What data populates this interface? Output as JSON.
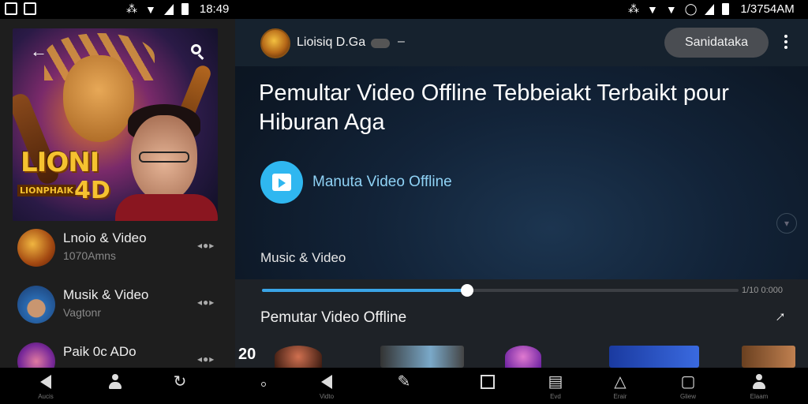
{
  "status_bar": {
    "time_left": "18:49",
    "time_right": "1/3754AM"
  },
  "left_panel": {
    "artwork": {
      "logo_text": "LIONI",
      "logo_sub": "LIONPHAIK",
      "logo_num": "4D"
    },
    "items": [
      {
        "title": "Lnoio & Video",
        "subtitle": "1070Amns",
        "meta": "◂●▸"
      },
      {
        "title": "Musik & Video",
        "subtitle": "Vagtonr",
        "meta": "◂●▸"
      },
      {
        "title": "Paik 0c ADo",
        "subtitle": "",
        "meta": "◂●▸"
      }
    ]
  },
  "channel": {
    "name": "Lioisiq D.Ga",
    "dash": "–",
    "subscribe_label": "Sanidataka"
  },
  "headline": "Pemultar Video Offline Tebbeiakt Terbaikt pour Hiburan Aga",
  "app_label": "Manuta Video Offline",
  "section_label": "Music & Video",
  "player": {
    "progress": 0.43,
    "time": "1/10 0:000",
    "title": "Pemutar Video Offline",
    "counter": "20"
  },
  "nav_left": [
    {
      "icon": "back-icon",
      "label": "Aucis"
    },
    {
      "icon": "person-icon",
      "label": ""
    },
    {
      "icon": "refresh-icon",
      "label": ""
    }
  ],
  "nav_right": [
    {
      "icon": "dot-icon",
      "label": ""
    },
    {
      "icon": "back-icon",
      "label": "Vidto"
    },
    {
      "icon": "edit-icon",
      "label": ""
    },
    {
      "icon": "window-icon",
      "label": ""
    },
    {
      "icon": "grid-icon",
      "label": "Evd"
    },
    {
      "icon": "alert-icon",
      "label": "Erair"
    },
    {
      "icon": "tabs-icon",
      "label": "Gliew"
    },
    {
      "icon": "profile-icon",
      "label": "Elaam"
    }
  ],
  "colors": {
    "accent": "#3aa4e6",
    "app_icon": "#2fb7f0",
    "background_right": "#0d1826",
    "background_left": "#1e1e1e"
  }
}
